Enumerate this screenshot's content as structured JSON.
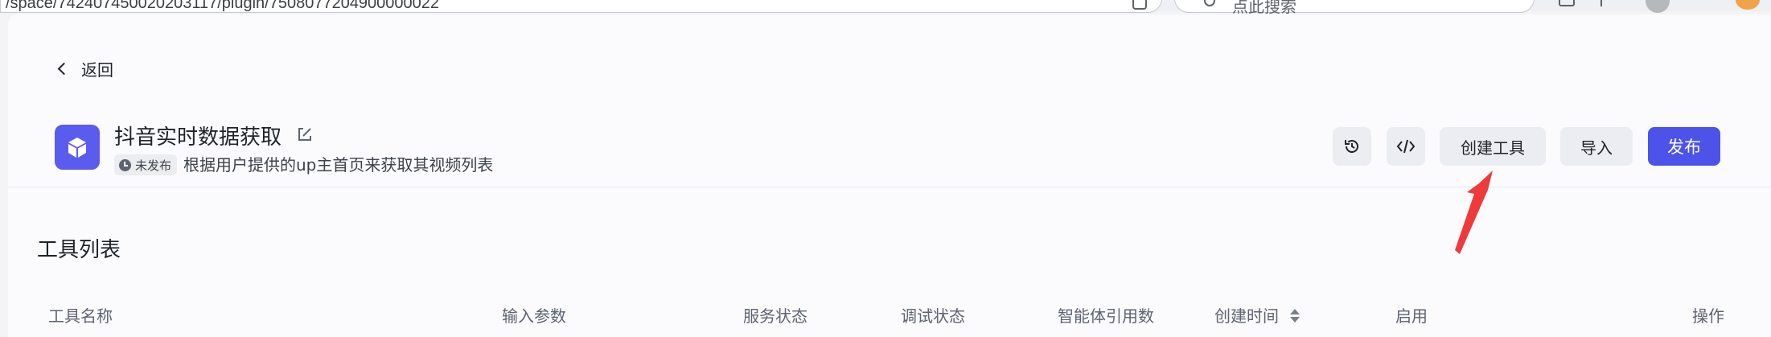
{
  "browser": {
    "url": "/space/742407450020203117/plugin/7508077204900000022",
    "search_placeholder": "点此搜索"
  },
  "header": {
    "back_label": "返回",
    "plugin_title": "抖音实时数据获取",
    "status_badge": "未发布",
    "description": "根据用户提供的up主首页来获取其视频列表"
  },
  "toolbar": {
    "create_tool_label": "创建工具",
    "import_label": "导入",
    "publish_label": "发布"
  },
  "tools_section": {
    "title": "工具列表",
    "columns": [
      "工具名称",
      "输入参数",
      "服务状态",
      "调试状态",
      "智能体引用数",
      "创建时间",
      "启用",
      "操作"
    ]
  },
  "colors": {
    "accent": "#4d53e8",
    "plugin_icon_bg": "#5a5cf0",
    "annotation_arrow": "#ee3a3a"
  }
}
